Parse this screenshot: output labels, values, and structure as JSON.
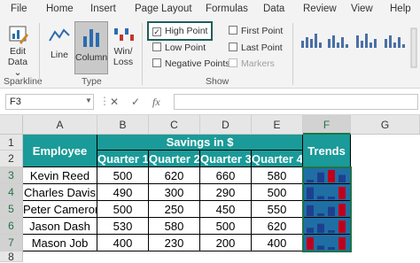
{
  "ribbon_tabs": [
    "File",
    "Home",
    "Insert",
    "Page Layout",
    "Formulas",
    "Data",
    "Review",
    "View",
    "Help"
  ],
  "ribbon": {
    "edit_data": "Edit\nData ⌄",
    "edit_line1": "Edit",
    "edit_line2": "Data ⌄",
    "group_sparkline": "Sparkline",
    "type_line": "Line",
    "type_column": "Column",
    "type_winloss_1": "Win/",
    "type_winloss_2": "Loss",
    "group_type": "Type",
    "show": {
      "high_point": "High Point",
      "low_point": "Low Point",
      "negative_points": "Negative Points",
      "first_point": "First Point",
      "last_point": "Last Point",
      "markers": "Markers"
    },
    "group_show": "Show"
  },
  "formula_bar": {
    "name_box": "F3",
    "cancel": "✕",
    "enter": "✓",
    "fx": "fx"
  },
  "columns": [
    "A",
    "B",
    "C",
    "D",
    "E",
    "F",
    "G"
  ],
  "rows": [
    "1",
    "2",
    "3",
    "4",
    "5",
    "6",
    "7",
    "8"
  ],
  "table": {
    "employee_header": "Employee",
    "savings_header": "Savings in $",
    "trends_header": "Trends",
    "quarters": [
      "Quarter 1",
      "Quarter 2",
      "Quarter 3",
      "Quarter 4"
    ],
    "rows": [
      {
        "name": "Kevin Reed",
        "values": [
          "500",
          "620",
          "660",
          "580"
        ],
        "nums": [
          500,
          620,
          660,
          580
        ]
      },
      {
        "name": "Charles Davis",
        "values": [
          "490",
          "300",
          "290",
          "500"
        ],
        "nums": [
          490,
          300,
          290,
          500
        ]
      },
      {
        "name": "Peter Cameron",
        "values": [
          "500",
          "250",
          "450",
          "550"
        ],
        "nums": [
          500,
          250,
          450,
          550
        ]
      },
      {
        "name": "Jason Dash",
        "values": [
          "530",
          "580",
          "500",
          "620"
        ],
        "nums": [
          530,
          580,
          500,
          620
        ]
      },
      {
        "name": "Mason Job",
        "values": [
          "400",
          "230",
          "200",
          "400"
        ],
        "nums": [
          400,
          230,
          200,
          400
        ]
      }
    ]
  },
  "colors": {
    "teal_header": "#1a9a98",
    "sparkline_bg": "#1f6fa5",
    "sparkline_bar": "#1e3f8f",
    "sparkline_high": "#c0001a",
    "excel_green": "#217346"
  }
}
